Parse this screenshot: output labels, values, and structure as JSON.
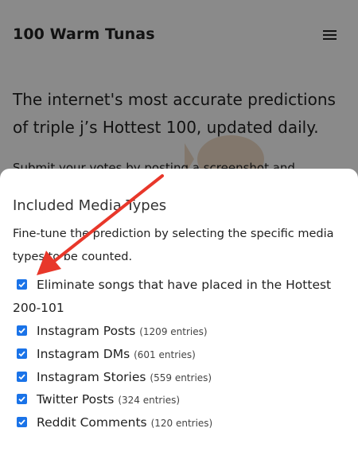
{
  "site": {
    "title": "100 Warm Tunas",
    "hero": "The internet's most accurate predictions of triple j’s Hottest 100, updated daily.",
    "sub": "Submit your votes by posting a screenshot and"
  },
  "modal": {
    "title": "Included Media Types",
    "description": "Fine-tune the prediction by selecting the specific media types to be counted.",
    "options": [
      {
        "label": "Eliminate songs that have placed in the Hottest 200-101",
        "count": "",
        "checked": true
      },
      {
        "label": "Instagram Posts",
        "count": "(1209 entries)",
        "checked": true
      },
      {
        "label": "Instagram DMs",
        "count": "(601 entries)",
        "checked": true
      },
      {
        "label": "Instagram Stories",
        "count": "(559 entries)",
        "checked": true
      },
      {
        "label": "Twitter Posts",
        "count": "(324 entries)",
        "checked": true
      },
      {
        "label": "Reddit Comments",
        "count": "(120 entries)",
        "checked": true
      }
    ]
  },
  "colors": {
    "checkbox": "#1a73e8",
    "arrow": "#e8372a",
    "overlay": "rgba(0,0,0,0.46)"
  },
  "icons": {
    "menu": "hamburger-menu-icon",
    "check": "checkmark-icon",
    "annotation": "red-arrow"
  }
}
